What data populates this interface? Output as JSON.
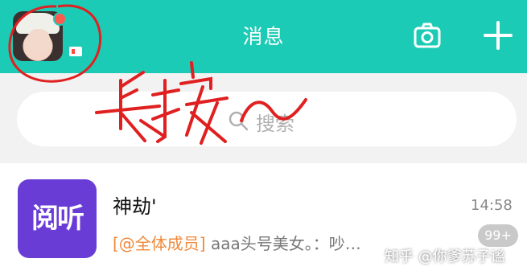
{
  "header": {
    "title": "消息",
    "bg_color": "#1ccbb5",
    "camera_icon": "camera-icon",
    "add_icon": "plus-icon"
  },
  "search": {
    "placeholder": "搜索"
  },
  "conversations": [
    {
      "icon_text": "阅听",
      "icon_color": "#6a3cd6",
      "name": "神劫'",
      "time": "14:58",
      "mention": "[@全体成员]",
      "message": " aaa头号美女。：吵…",
      "unread": "99+"
    }
  ],
  "annotation": {
    "text": "长按~",
    "color": "#e02020"
  },
  "watermark": "知乎 @你爹苏子谧"
}
